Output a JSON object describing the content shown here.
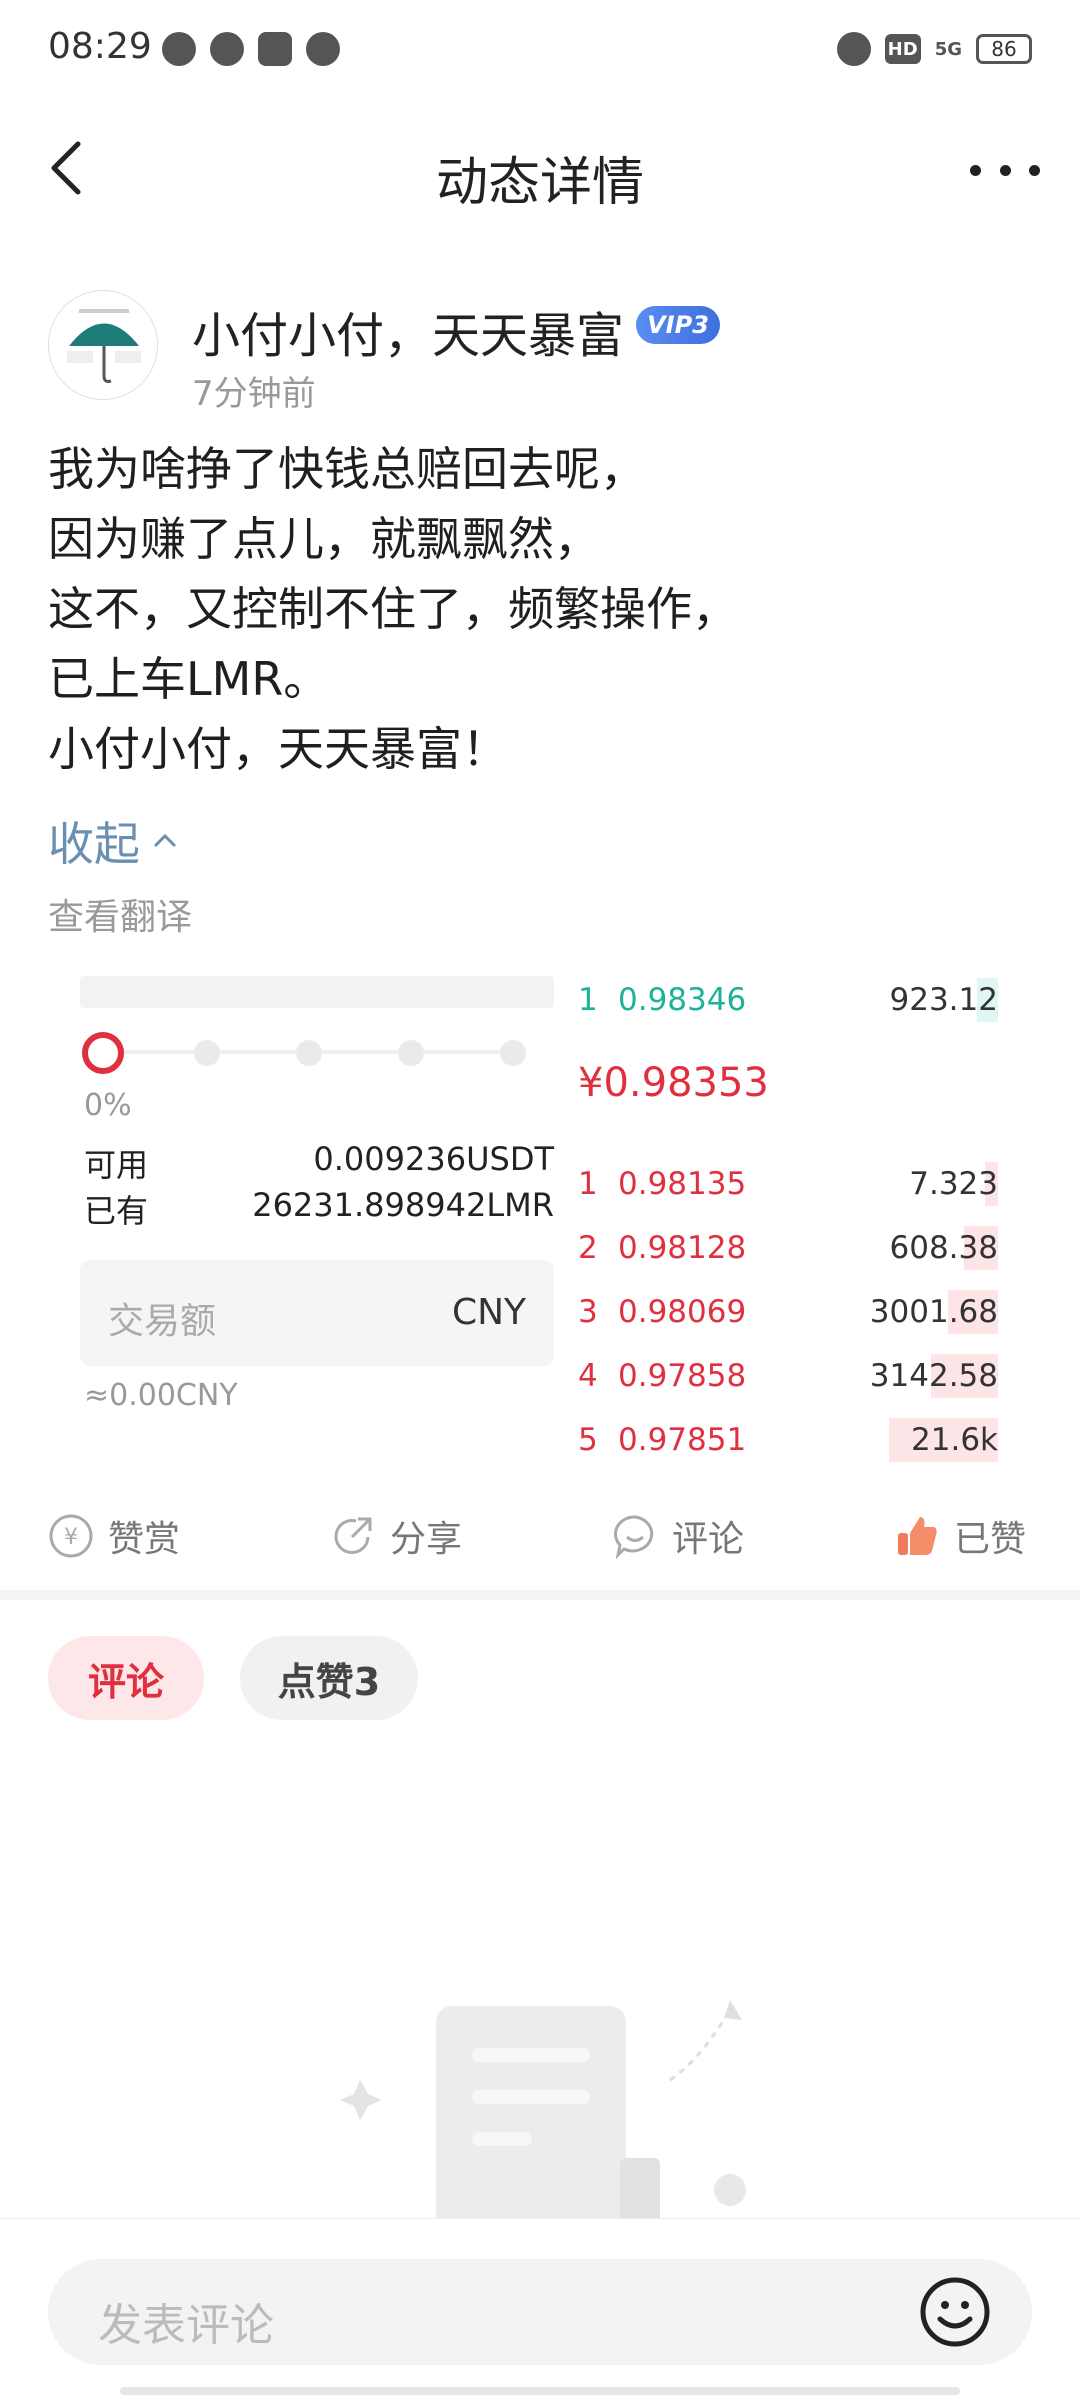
{
  "status_bar": {
    "time": "08:29",
    "battery": "86",
    "network": "5G",
    "hd": "HD"
  },
  "header": {
    "title": "动态详情"
  },
  "post": {
    "author": "小付小付，天天暴富",
    "vip": "VIP3",
    "time": "7分钟前",
    "lines": [
      "我为啥挣了快钱总赔回去呢，",
      "因为赚了点儿，就飘飘然，",
      "这不，又控制不住了，频繁操作，",
      "已上车LMR。",
      "小付小付，天天暴富！"
    ],
    "collapse_label": "收起",
    "translate_label": "查看翻译"
  },
  "trade": {
    "slider_percent": "0%",
    "available_label": "可用",
    "available_value": "0.009236USDT",
    "held_label": "已有",
    "held_value": "26231.898942LMR",
    "input_placeholder": "交易额",
    "input_unit": "CNY",
    "approx": "≈0.00CNY",
    "last_price": "¥0.98353",
    "asks": [
      {
        "idx": "1",
        "price": "0.98346",
        "qty": "923.12",
        "depth": 0.05
      }
    ],
    "bids": [
      {
        "idx": "1",
        "price": "0.98135",
        "qty": "7.323",
        "depth": 0.03
      },
      {
        "idx": "2",
        "price": "0.98128",
        "qty": "608.38",
        "depth": 0.08
      },
      {
        "idx": "3",
        "price": "0.98069",
        "qty": "3001.68",
        "depth": 0.12
      },
      {
        "idx": "4",
        "price": "0.97858",
        "qty": "3142.58",
        "depth": 0.16
      },
      {
        "idx": "5",
        "price": "0.97851",
        "qty": "21.6k",
        "depth": 0.26
      }
    ]
  },
  "actions": {
    "reward": "赞赏",
    "share": "分享",
    "comment": "评论",
    "liked": "已赞"
  },
  "tabs": {
    "comments": "评论",
    "likes": "点赞3"
  },
  "bottom": {
    "placeholder": "发表评论"
  },
  "colors": {
    "accent_red": "#e0303f",
    "ask_green": "#1bb39a",
    "link_blue": "#6a8fb0"
  }
}
